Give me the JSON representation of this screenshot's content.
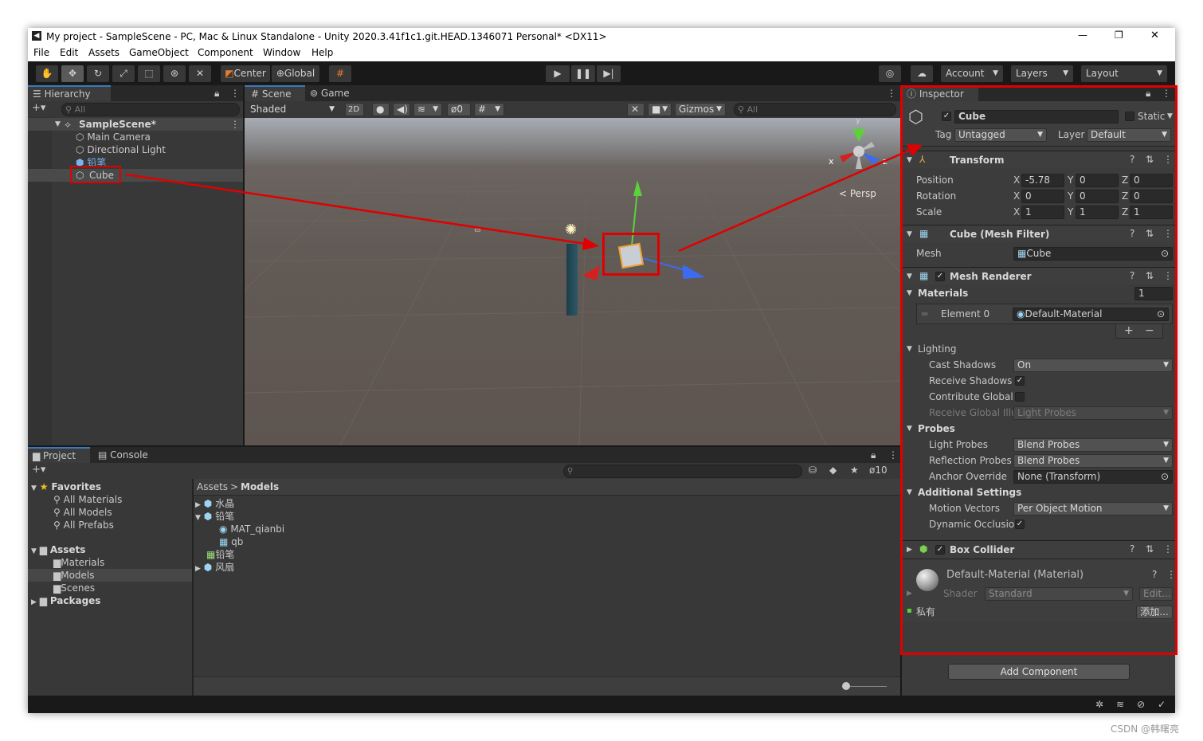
{
  "window": {
    "title": "My project - SampleScene - PC, Mac & Linux Standalone - Unity 2020.3.41f1c1.git.HEAD.1346071 Personal* <DX11>",
    "min": "—",
    "max": "❐",
    "close": "✕"
  },
  "menu": [
    "File",
    "Edit",
    "Assets",
    "GameObject",
    "Component",
    "Window",
    "Help"
  ],
  "toolbar": {
    "center": "Center",
    "global": "Global",
    "account": "Account",
    "layers": "Layers",
    "layout": "Layout"
  },
  "hierarchy": {
    "tab": "Hierarchy",
    "search": "All",
    "add": "+▾",
    "scene": "SampleScene*",
    "items": [
      "Main Camera",
      "Directional Light",
      "铅笔",
      "Cube"
    ]
  },
  "scene": {
    "tab_scene": "Scene",
    "tab_game": "Game",
    "shading": "Shaded",
    "mode2d": "2D",
    "hidden_count": "0",
    "gizmos": "Gizmos",
    "search": "All",
    "persp": "< Persp",
    "axis_x": "x",
    "axis_y": "y",
    "axis_z": "z"
  },
  "project": {
    "tab_project": "Project",
    "tab_console": "Console",
    "add": "+▾",
    "hidden_count": "10",
    "favorites": "Favorites",
    "fav_items": [
      "All Materials",
      "All Models",
      "All Prefabs"
    ],
    "assets": "Assets",
    "asset_items": [
      "Materials",
      "Models",
      "Scenes"
    ],
    "packages": "Packages",
    "breadcrumb_root": "Assets",
    "breadcrumb_sep": ">",
    "breadcrumb_current": "Models",
    "files": [
      "水晶",
      "铅笔",
      "MAT_qianbi",
      "qb",
      "铅笔",
      "风扇"
    ]
  },
  "inspector": {
    "tab": "Inspector",
    "object_name": "Cube",
    "static": "Static",
    "tag_label": "Tag",
    "tag_value": "Untagged",
    "layer_label": "Layer",
    "layer_value": "Default",
    "transform": {
      "title": "Transform",
      "rows": [
        {
          "label": "Position",
          "x": "-5.78",
          "y": "0",
          "z": "0"
        },
        {
          "label": "Rotation",
          "x": "0",
          "y": "0",
          "z": "0"
        },
        {
          "label": "Scale",
          "x": "1",
          "y": "1",
          "z": "1"
        }
      ],
      "ax": "X",
      "ay": "Y",
      "az": "Z"
    },
    "mesh_filter": {
      "title": "Cube (Mesh Filter)",
      "mesh_label": "Mesh",
      "mesh_value": "Cube"
    },
    "mesh_renderer": {
      "title": "Mesh Renderer",
      "materials_label": "Materials",
      "materials_count": "1",
      "element_label": "Element 0",
      "element_value": "Default-Material",
      "plus": "+",
      "minus": "−",
      "lighting_label": "Lighting",
      "cast_shadows_label": "Cast Shadows",
      "cast_shadows_value": "On",
      "receive_shadows_label": "Receive Shadows",
      "contribute_gi_label": "Contribute Global I",
      "receive_gi_label": "Receive Global Illu",
      "receive_gi_value": "Light Probes",
      "probes_label": "Probes",
      "light_probes_label": "Light Probes",
      "light_probes_value": "Blend Probes",
      "reflection_probes_label": "Reflection Probes",
      "reflection_probes_value": "Blend Probes",
      "anchor_label": "Anchor Override",
      "anchor_value": "None (Transform)",
      "additional_label": "Additional Settings",
      "motion_label": "Motion Vectors",
      "motion_value": "Per Object Motion",
      "occlusion_label": "Dynamic Occlusio"
    },
    "box_collider": {
      "title": "Box Collider"
    },
    "material": {
      "name": "Default-Material (Material)",
      "shader_label": "Shader",
      "shader_value": "Standard",
      "edit": "Edit...",
      "private_label": "私有",
      "add": "添加..."
    },
    "add_component": "Add Component"
  },
  "watermark": "CSDN @韩曙亮",
  "colors": {
    "highlight_red": "#e00000",
    "selection_blue": "#3a79bb"
  }
}
